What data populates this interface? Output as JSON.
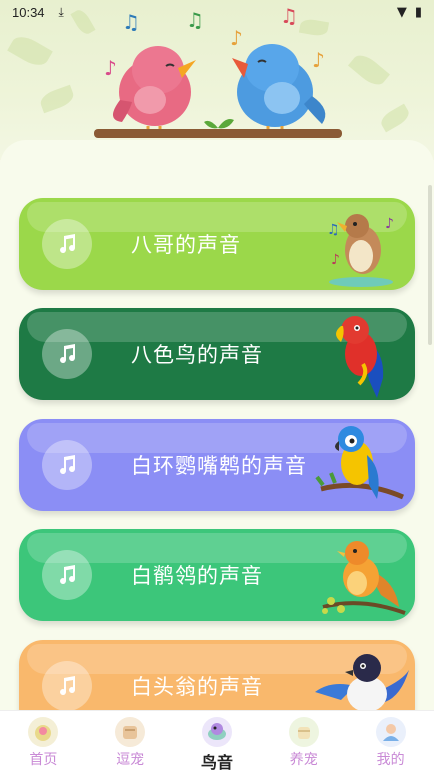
{
  "status_bar": {
    "time": "10:34"
  },
  "cards": [
    {
      "label": "八哥的声音",
      "color": "#9bd84a",
      "dark": "#86c63a"
    },
    {
      "label": "八色鸟的声音",
      "color": "#1e7a45",
      "dark": "#17683a"
    },
    {
      "label": "白环鹦嘴鹎的声音",
      "color": "#8b8ef5",
      "dark": "#7a7de6"
    },
    {
      "label": "白鹡鸰的声音",
      "color": "#3cc67a",
      "dark": "#2fb56a"
    },
    {
      "label": "白头翁的声音",
      "color": "#f9b86c",
      "dark": "#f0a857"
    }
  ],
  "nav": [
    {
      "label": "首页",
      "icon": "home-icon"
    },
    {
      "label": "逗宠",
      "icon": "pet-play-icon"
    },
    {
      "label": "鸟音",
      "icon": "bird-sound-icon",
      "active": true
    },
    {
      "label": "养宠",
      "icon": "pet-care-icon"
    },
    {
      "label": "我的",
      "icon": "profile-icon"
    }
  ]
}
